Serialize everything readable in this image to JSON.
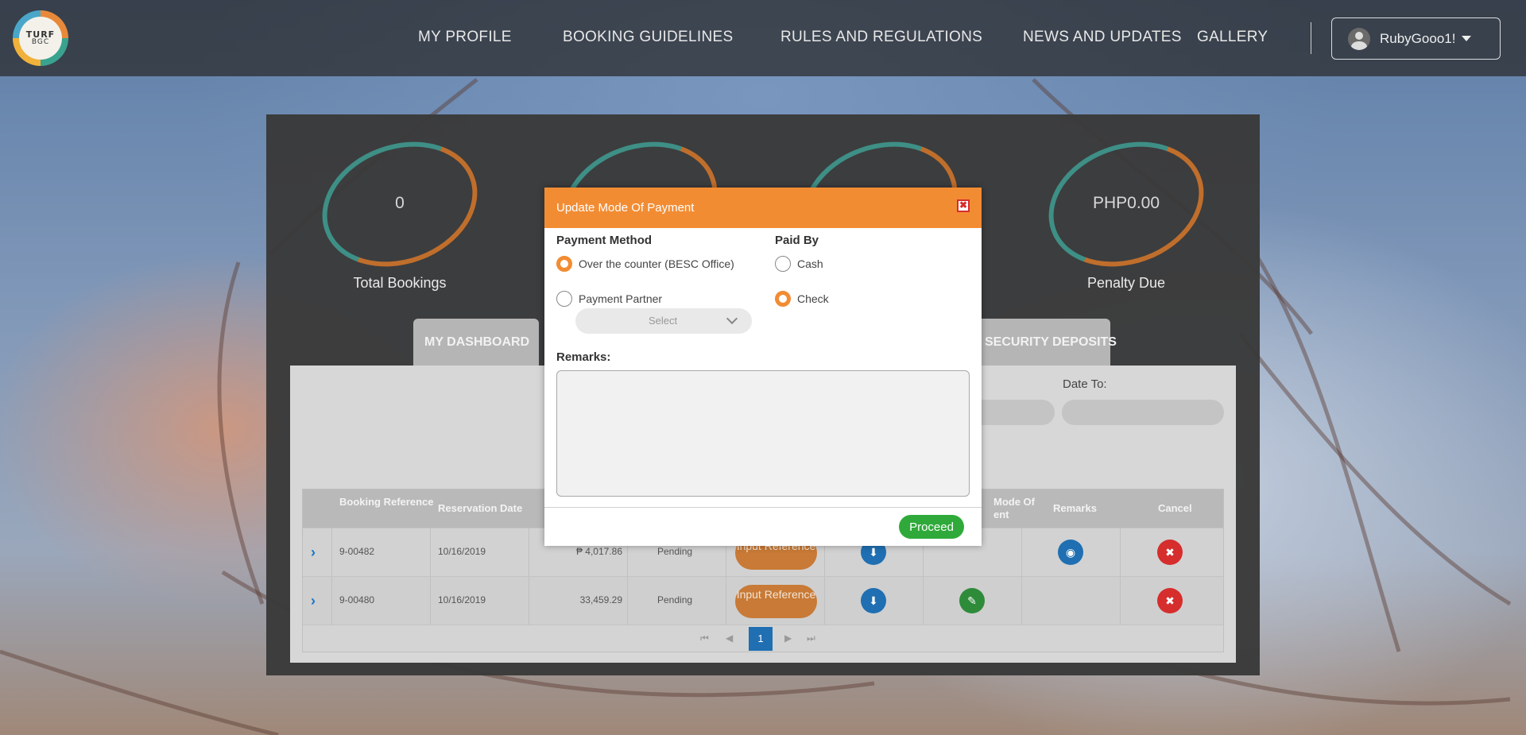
{
  "logo": {
    "line1": "TURF",
    "line2": "BGC"
  },
  "nav": {
    "items": [
      {
        "label": "MY PROFILE"
      },
      {
        "label": "BOOKING GUIDELINES"
      },
      {
        "label": "RULES AND REGULATIONS"
      },
      {
        "label": "NEWS AND UPDATES"
      },
      {
        "label": "GALLERY"
      }
    ],
    "user": "RubyGooo1!"
  },
  "stats": [
    {
      "value": "0",
      "label": "Total Bookings"
    },
    {
      "value": "",
      "label": ""
    },
    {
      "value": "",
      "label": ""
    },
    {
      "value": "PHP0.00",
      "label": "Penalty Due"
    }
  ],
  "tabs": {
    "dashboard": "MY DASHBOARD",
    "deposits": "SECURITY DEPOSITS"
  },
  "filters": {
    "date_to_label": "Date To:"
  },
  "table": {
    "headers": {
      "booking_ref": "Booking Reference",
      "reservation_date": "Reservation Date",
      "mode_of_payment": "Mode Of",
      "mode_of_payment_2": "ent",
      "remarks": "Remarks",
      "cancel": "Cancel"
    },
    "rows": [
      {
        "ref": "9-00482",
        "date": "10/16/2019",
        "amount": "₱ 4,017.86",
        "status": "Pending",
        "action": "Input Reference"
      },
      {
        "ref": "9-00480",
        "date": "10/16/2019",
        "amount": "33,459.29",
        "status": "Pending",
        "action": "Input Reference"
      }
    ],
    "current_page": "1"
  },
  "modal": {
    "title": "Update Mode Of Payment",
    "close_icon": "✖",
    "payment_method_label": "Payment Method",
    "options": {
      "over_counter": "Over the counter (BESC Office)",
      "partner": "Payment Partner"
    },
    "partner_select_placeholder": "Select",
    "paid_by_label": "Paid By",
    "paid_by": {
      "cash": "Cash",
      "check": "Check"
    },
    "selected_method": "over_counter",
    "selected_paid_by": "check",
    "remarks_label": "Remarks:",
    "remarks_value": "",
    "proceed_label": "Proceed"
  },
  "colors": {
    "accent": "#f28c33",
    "proceed": "#2faa3a",
    "primary": "#1f6fb2",
    "danger": "#d62d2d"
  }
}
